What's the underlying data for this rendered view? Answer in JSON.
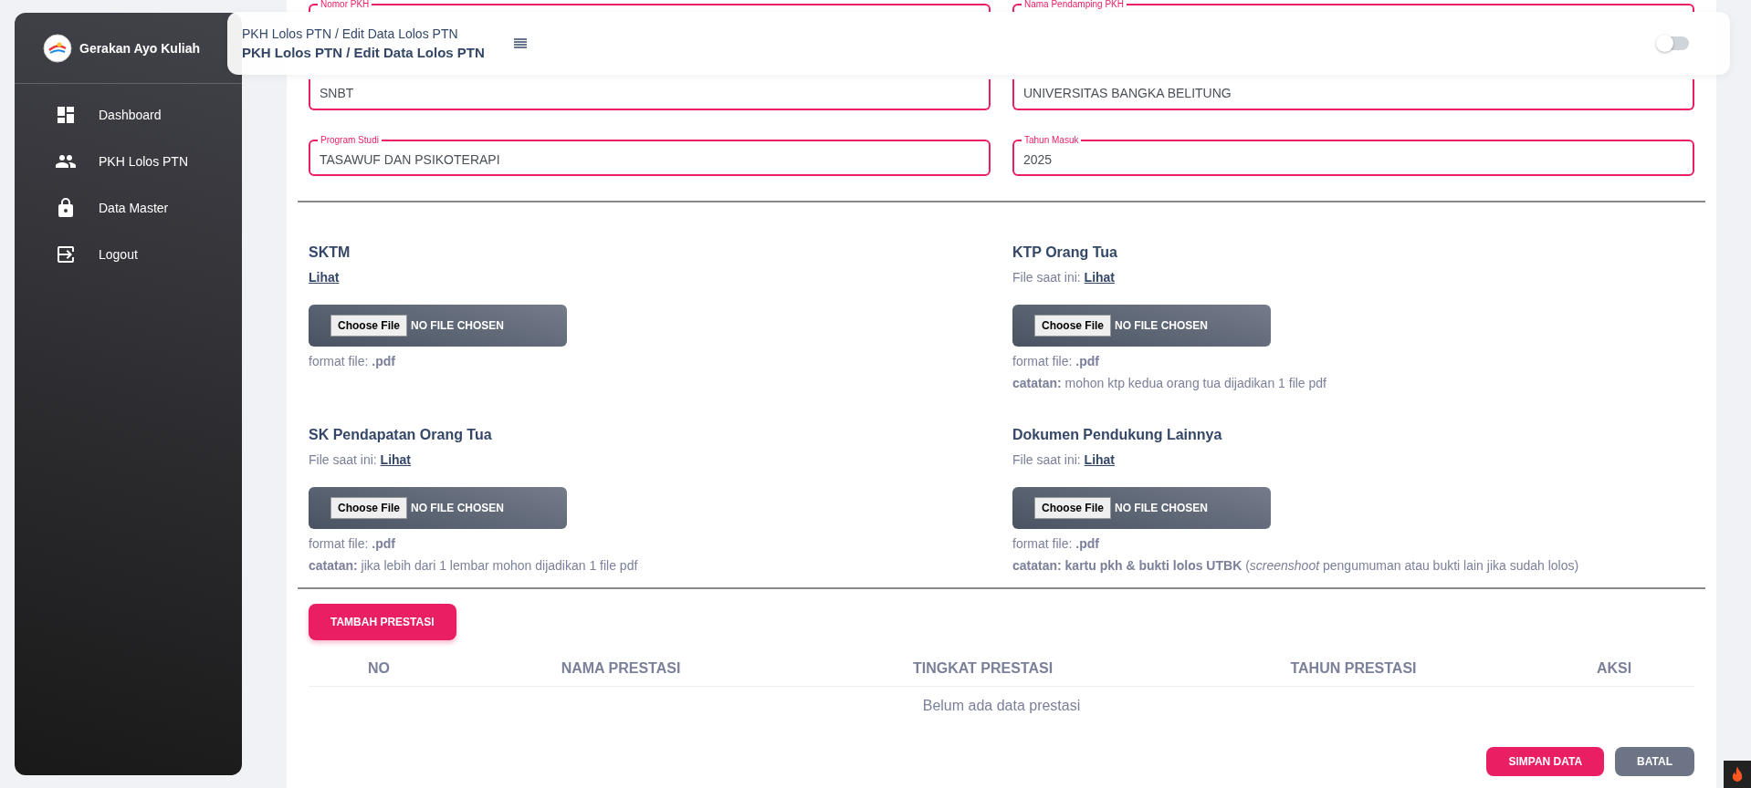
{
  "sidebar": {
    "brand": "Gerakan Ayo Kuliah",
    "items": [
      {
        "label": "Dashboard",
        "selected": false
      },
      {
        "label": "PKH Lolos PTN",
        "selected": false
      },
      {
        "label": "Data Master",
        "selected": false
      },
      {
        "label": "Logout",
        "selected": false
      }
    ]
  },
  "navbar": {
    "breadcrumb": "PKH Lolos PTN / Edit Data Lolos PTN",
    "title": "PKH Lolos PTN / Edit Data Lolos PTN",
    "toggle": {
      "on": false
    }
  },
  "fields": [
    {
      "label": "Nomor PKH"
    },
    {
      "label": "Nama Pendamping PKH"
    },
    {
      "value": "SNBT"
    },
    {
      "value": "UNIVERSITAS BANGKA BELITUNG"
    },
    {
      "label": "Program Studi",
      "value": "TASAWUF DAN PSIKOTERAPI"
    },
    {
      "label": "Tahun Masuk",
      "value": "2025"
    }
  ],
  "uploads": [
    {
      "title": "SKTM",
      "link": "Lihat",
      "button": "Choose File",
      "status": "NO FILE CHOSEN",
      "format": "format file: **.pdf**"
    },
    {
      "title": "KTP Orang Tua",
      "current": "File saat ini:",
      "link": "Lihat",
      "button": "Choose File",
      "status": "NO FILE CHOSEN",
      "format": "format file: **.pdf**",
      "note": "**catatan:** mohon ktp kedua orang tua dijadikan 1 file pdf"
    },
    {
      "title": "SK Pendapatan Orang Tua",
      "current": "File saat ini:",
      "link": "Lihat",
      "button": "Choose File",
      "status": "NO FILE CHOSEN",
      "format": "format file: **.pdf**",
      "note": "**catatan:** jika lebih dari 1 lembar mohon dijadikan 1 file pdf"
    },
    {
      "title": "Dokumen Pendukung Lainnya",
      "current": "File saat ini:",
      "link": "Lihat",
      "button": "Choose File",
      "status": "NO FILE CHOSEN",
      "format": "format file: **.pdf**",
      "note": "**catatan: kartu pkh & bukti lolos UTBK** (*screenshoot* pengumuman atau bukti lain jika sudah lolos)"
    }
  ],
  "add_button": "TAMBAH PRESTASI",
  "table": {
    "columns": [
      "NO",
      "NAMA PRESTASI",
      "TINGKAT PRESTASI",
      "TAHUN PRESTASI",
      "AKSI"
    ],
    "empty": "Belum ada data prestasi"
  },
  "actions": [
    {
      "label": "SIMPAN DATA",
      "kind": "primary"
    },
    {
      "label": "BATAL",
      "kind": "secondary"
    }
  ]
}
